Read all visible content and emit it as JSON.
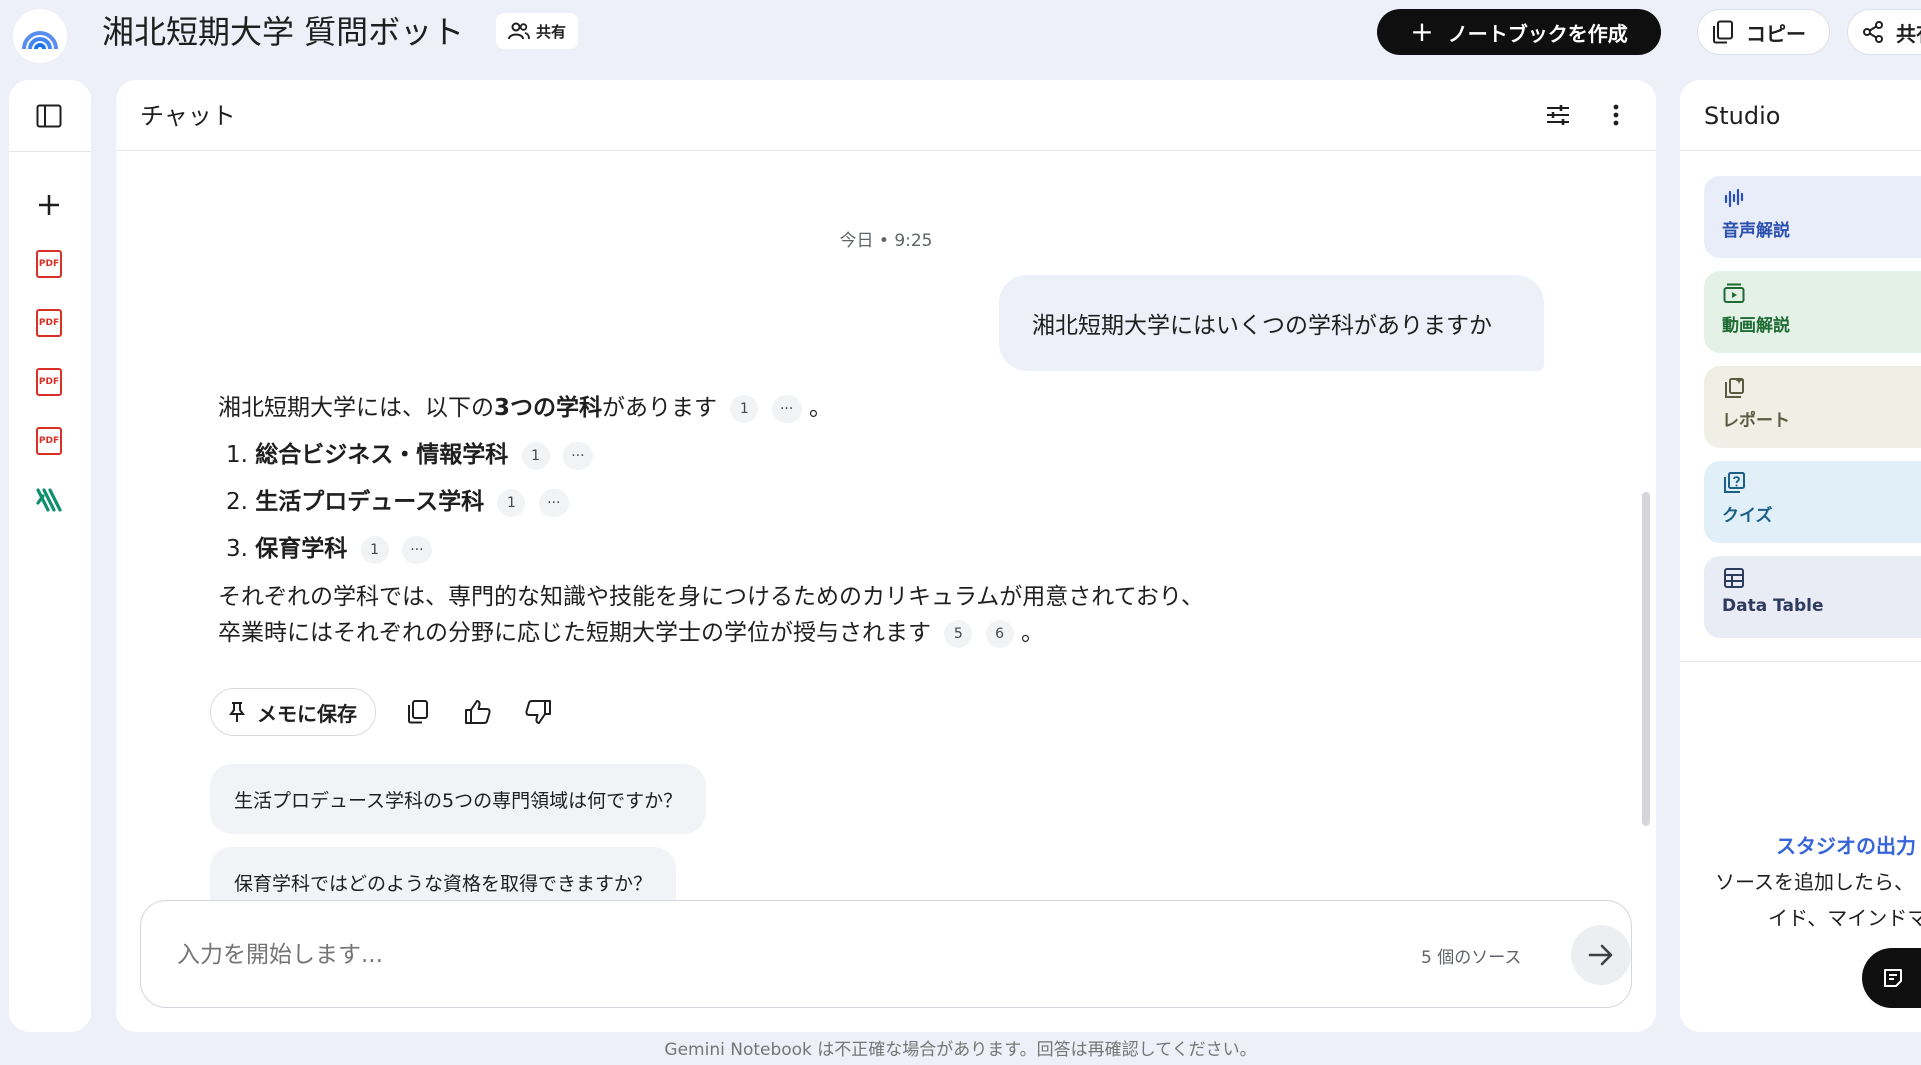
{
  "app": {
    "title": "湘北短期大学 質問ボット",
    "share_chip": "共有",
    "create_notebook": "ノートブックを作成",
    "copy": "コピー",
    "share": "共有"
  },
  "colors": {
    "background": "#eef0f9",
    "pdf_red": "#d93025",
    "accent_green": "#0f8f6b",
    "link_blue": "#3764d9",
    "tile_audio": "#e8edf9",
    "tile_video": "#e3f1e6",
    "tile_report": "#f0efe6",
    "tile_quiz": "#e1f0f8",
    "tile_table": "#eaecf5"
  },
  "sidebar": {
    "icons": [
      "panel-toggle-icon",
      "add-source-icon",
      "pdf-icon",
      "pdf-icon",
      "pdf-icon",
      "pdf-icon",
      "web-source-icon"
    ],
    "pdf_label": "PDF"
  },
  "chat": {
    "title": "チャット",
    "timestamp": "今日 • 9:25",
    "user_message": "湘北短期大学にはいくつの学科がありますか",
    "answer": {
      "intro_prefix": "湘北短期大学には、以下の",
      "intro_bold": "3つの学科",
      "intro_suffix": "があります",
      "intro_cite": "1",
      "more": "···",
      "period": "。",
      "items": [
        {
          "num": "1.",
          "label": "総合ビジネス・情報学科",
          "cite": "1"
        },
        {
          "num": "2.",
          "label": "生活プロデュース学科",
          "cite": "1"
        },
        {
          "num": "3.",
          "label": "保育学科",
          "cite": "1"
        }
      ],
      "para_line1": "それぞれの学科では、専門的な知識や技能を身につけるためのカリキュラムが用意されており、",
      "para_line2": "卒業時にはそれぞれの分野に応じた短期大学士の学位が授与されます",
      "para_cites": [
        "5",
        "6"
      ]
    },
    "save_to_memo": "メモに保存",
    "suggestions": [
      "生活プロデュース学科の5つの専門領域は何ですか？",
      "保育学科ではどのような資格を取得できますか？"
    ],
    "input_placeholder": "入力を開始します...",
    "source_count": "5 個のソース"
  },
  "studio": {
    "title": "Studio",
    "tiles": [
      {
        "label": "音声解説",
        "icon": "audio-overview-icon"
      },
      {
        "label": "動画解説",
        "icon": "video-overview-icon"
      },
      {
        "label": "レポート",
        "icon": "report-icon"
      },
      {
        "label": "クイズ",
        "icon": "quiz-icon"
      },
      {
        "label": "Data Table",
        "icon": "data-table-icon"
      }
    ],
    "output_title": "スタジオの出力",
    "output_line1": "ソースを追加したら、",
    "output_line2": "イド、マインドマ"
  },
  "footer": "Gemini Notebook は不正確な場合があります。回答は再確認してください。"
}
